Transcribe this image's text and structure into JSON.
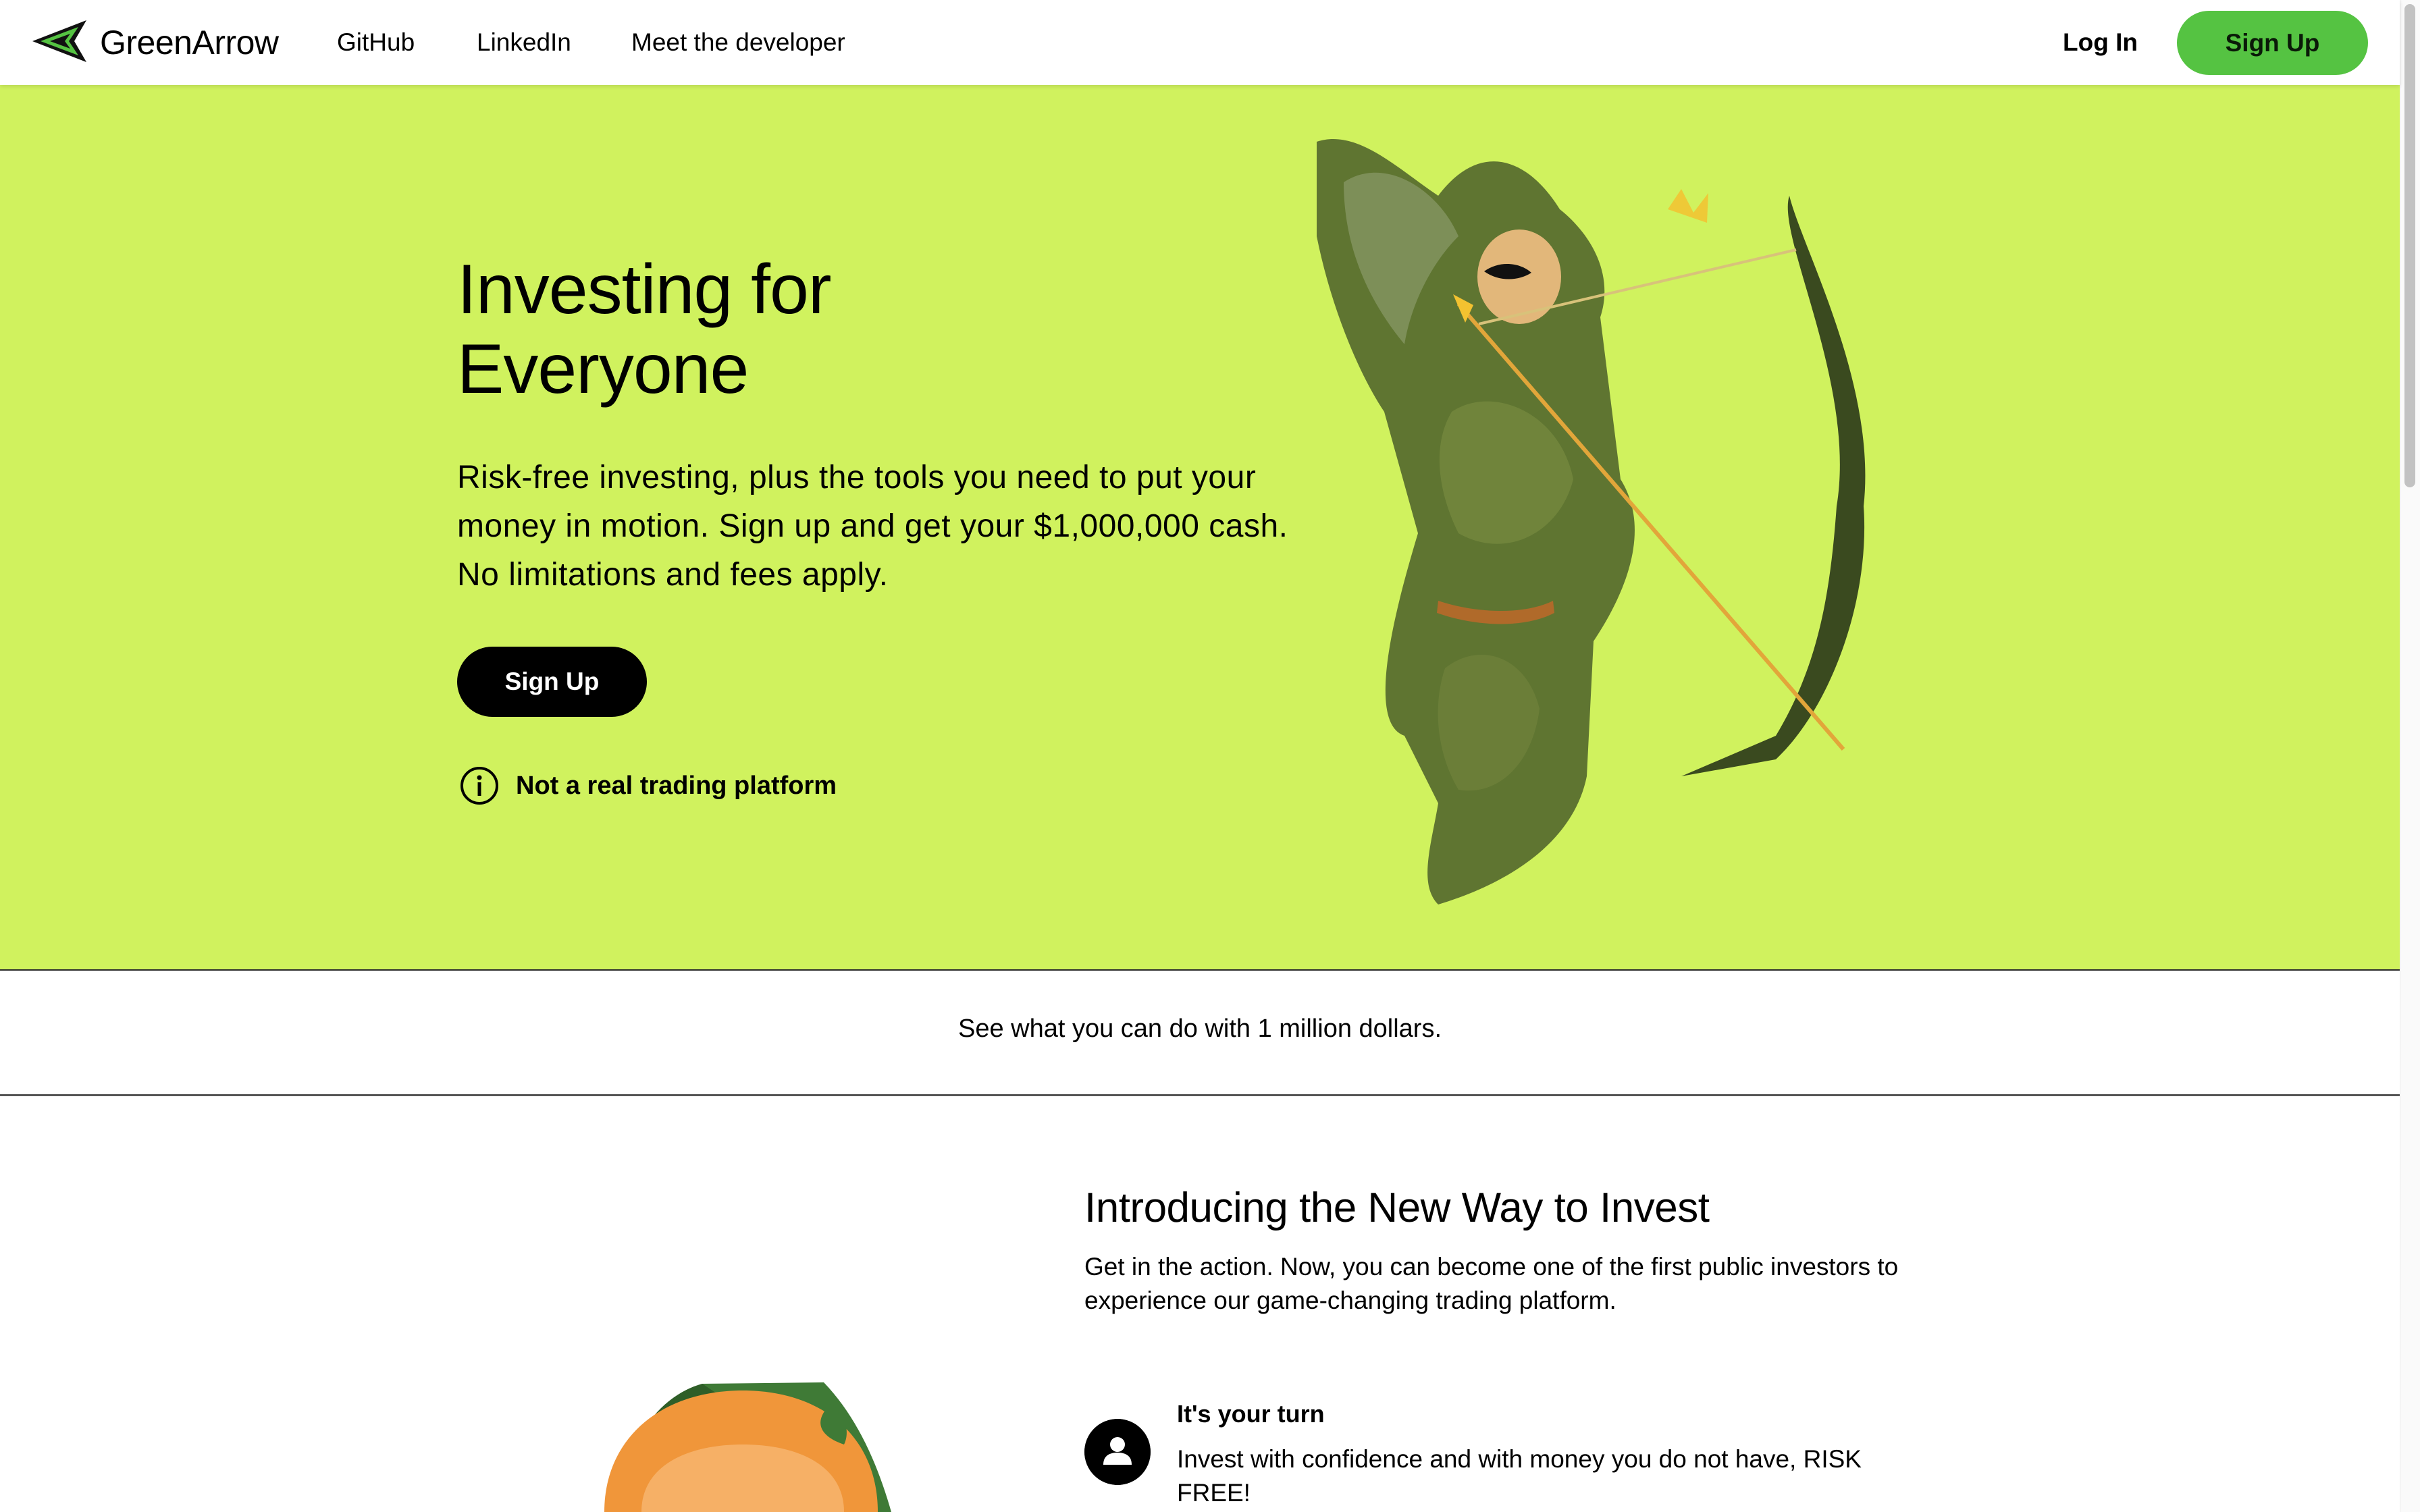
{
  "nav": {
    "brand": "GreenArrow",
    "links": [
      "GitHub",
      "LinkedIn",
      "Meet the developer"
    ],
    "login_label": "Log In",
    "signup_label": "Sign Up"
  },
  "hero": {
    "title": "Investing for Everyone",
    "description": "Risk-free investing, plus the tools you need to put your money in motion. Sign up and get your $1,000,000 cash. No limitations and fees apply.",
    "signup_label": "Sign Up",
    "disclaimer": "Not a real trading platform"
  },
  "band": {
    "text": "See what you can do with 1 million dollars."
  },
  "intro": {
    "title": "Introducing the New Way to Invest",
    "description": "Get in the action. Now, you can become one of the first public investors to experience our game-changing trading platform.",
    "feature": {
      "title": "It's your turn",
      "description": "Invest with confidence and with money you do not have, RISK FREE!"
    }
  },
  "colors": {
    "hero_bg": "#d0f25e",
    "brand_green": "#55c342",
    "text": "#000000"
  },
  "icons": {
    "logo": "arrow-logo-icon",
    "info": "info-circle-icon",
    "feature": "person-icon"
  }
}
